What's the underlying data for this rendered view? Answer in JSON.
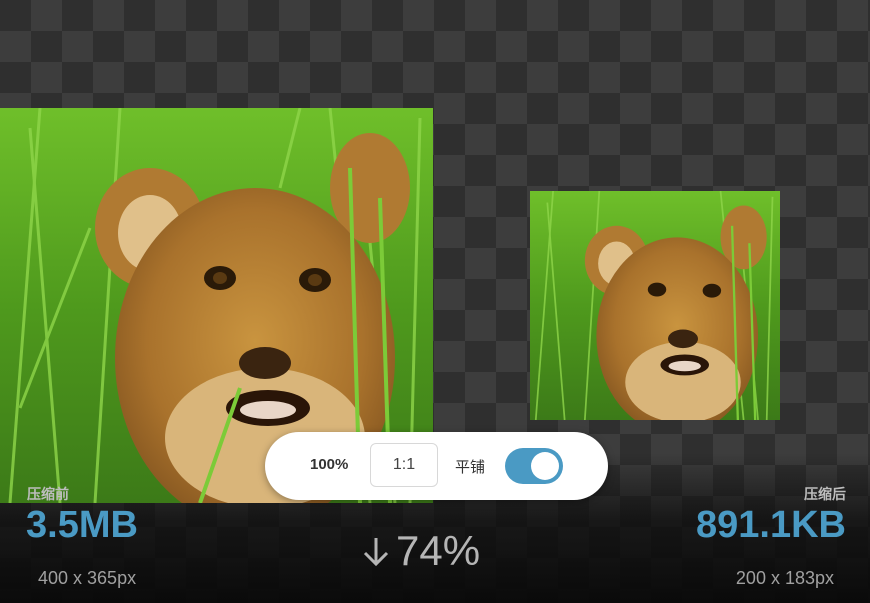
{
  "toolbar": {
    "zoom": "100%",
    "ratio_button": "1:1",
    "tile_label": "平铺",
    "tile_enabled": true
  },
  "before": {
    "caption": "压缩前",
    "size": "3.5MB",
    "dimensions": "400 x 365px"
  },
  "after": {
    "caption": "压缩后",
    "size": "891.1KB",
    "dimensions": "200 x 183px"
  },
  "reduction": {
    "percent": "74%",
    "icon": "arrow-down-icon"
  },
  "colors": {
    "accent": "#4a9ac4",
    "checker_dark": "#2f2f2f",
    "checker_light": "#3d3d3d"
  }
}
